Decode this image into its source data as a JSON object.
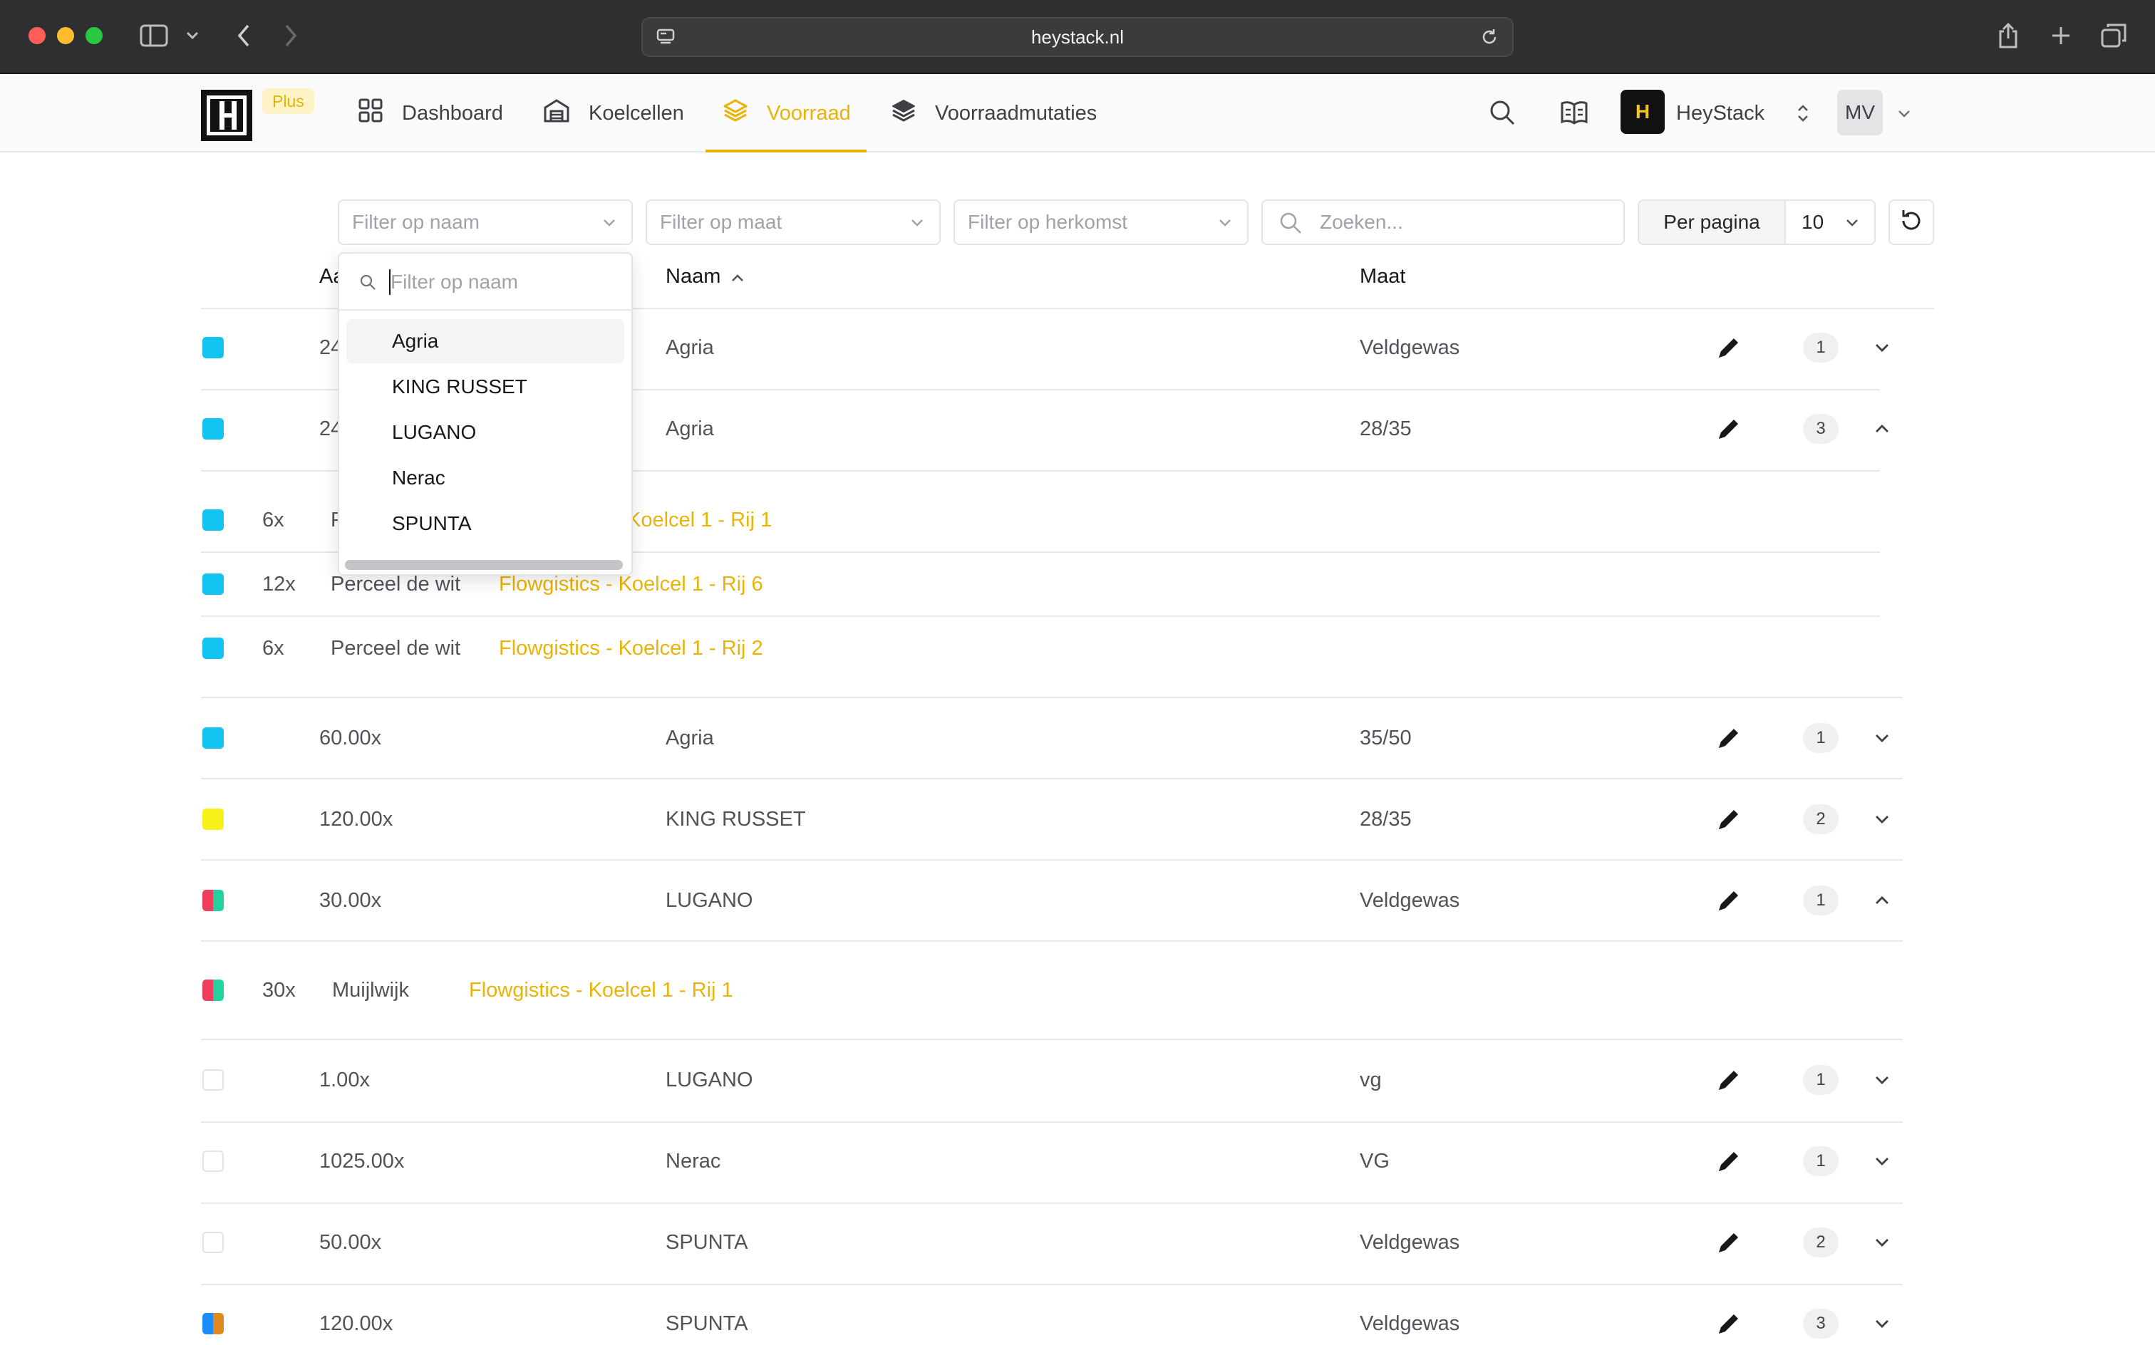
{
  "browser": {
    "url": "heystack.nl"
  },
  "nav": {
    "plan_badge": "Plus",
    "items": [
      {
        "label": "Dashboard",
        "icon": "grid-icon"
      },
      {
        "label": "Koelcellen",
        "icon": "warehouse-icon"
      },
      {
        "label": "Voorraad",
        "icon": "layers-icon",
        "active": true
      },
      {
        "label": "Voorraadmutaties",
        "icon": "stack-icon"
      }
    ],
    "org_initial": "H",
    "org_name": "HeyStack",
    "user_initials": "MV"
  },
  "filters": {
    "naam": "Filter op naam",
    "maat": "Filter op maat",
    "herkomst": "Filter op herkomst",
    "search": "Zoeken...",
    "per_page_label": "Per pagina",
    "per_page_value": "10"
  },
  "table": {
    "headers": {
      "amount": "Aa",
      "name": "Naam",
      "size": "Maat"
    }
  },
  "rows": [
    {
      "amount": "24",
      "name": "Agria",
      "size": "Veldgewas",
      "count": "1",
      "color": "#13c3f2"
    },
    {
      "amount": "24",
      "name": "Agria",
      "size": "28/35",
      "count": "3",
      "color": "#13c3f2",
      "expanded": true
    },
    {
      "amount": "60.00x",
      "name": "Agria",
      "size": "35/50",
      "count": "1",
      "color": "#13c3f2"
    },
    {
      "amount": "120.00x",
      "name": "KING RUSSET",
      "size": "28/35",
      "count": "2",
      "color": "#f7f01b"
    },
    {
      "amount": "30.00x",
      "name": "LUGANO",
      "size": "Veldgewas",
      "count": "1",
      "color": "#ef3e5b|#22d3a0",
      "expanded": true
    },
    {
      "amount": "1.00x",
      "name": "LUGANO",
      "size": "vg",
      "count": "1",
      "color": "none"
    },
    {
      "amount": "1025.00x",
      "name": "Nerac",
      "size": "VG",
      "count": "1",
      "color": "none"
    },
    {
      "amount": "50.00x",
      "name": "SPUNTA",
      "size": "Veldgewas",
      "count": "2",
      "color": "none"
    },
    {
      "amount": "120.00x",
      "name": "SPUNTA",
      "size": "Veldgewas",
      "count": "3",
      "color": "#1a8cff|#e08a1e"
    }
  ],
  "subrows": [
    {
      "qty": "6x",
      "origin": "P",
      "location": "Koelcel 1 - Rij 1"
    },
    {
      "qty": "12x",
      "origin": "Perceel de wit",
      "location": "Flowgistics - Koelcel 1 - Rij 6"
    },
    {
      "qty": "6x",
      "origin": "Perceel de wit",
      "location": "Flowgistics - Koelcel 1 - Rij 2"
    },
    {
      "qty": "30x",
      "origin": "Muijlwijk",
      "location": "Flowgistics - Koelcel 1 - Rij 1"
    }
  ],
  "dropdown": {
    "placeholder": "Filter op naam",
    "options": [
      "Agria",
      "KING RUSSET",
      "LUGANO",
      "Nerac",
      "SPUNTA"
    ]
  }
}
